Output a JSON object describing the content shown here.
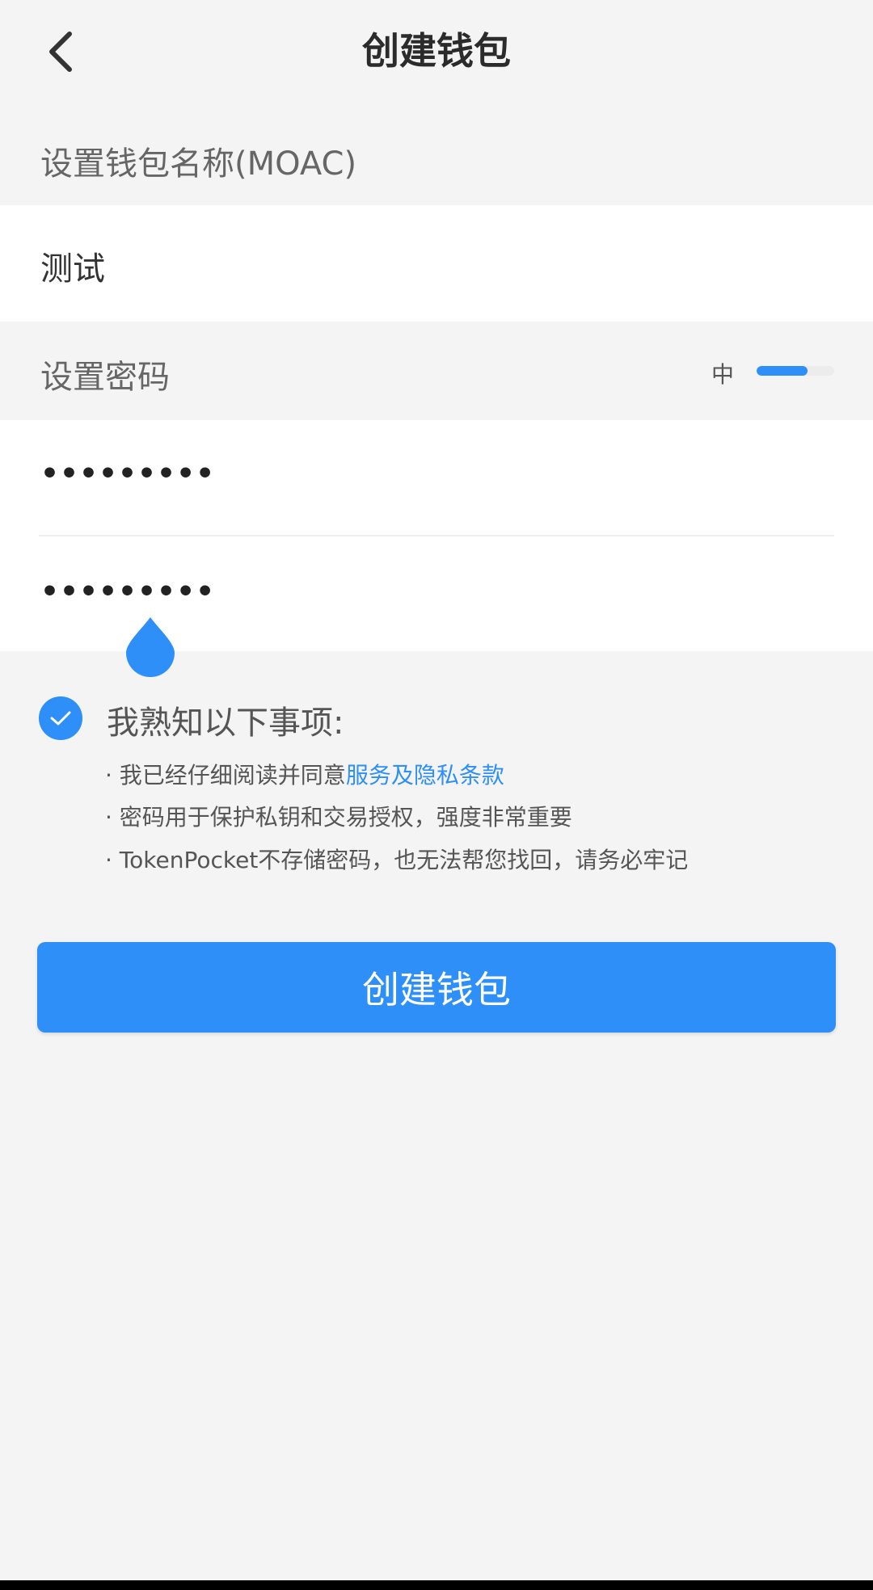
{
  "header": {
    "title": "创建钱包",
    "back_icon": "chevron-left-icon"
  },
  "wallet_name": {
    "label": "设置钱包名称(MOAC)",
    "value": "测试"
  },
  "password": {
    "label": "设置密码",
    "strength_text": "中",
    "strength_fraction": 0.66,
    "password_value": "•••••••••",
    "confirm_value": "•••••••••"
  },
  "acknowledge": {
    "checked": true,
    "title": "我熟知以下事项:",
    "item1_prefix": "· 我已经仔细阅读并同意",
    "item1_link": "服务及隐私条款",
    "item2": "· 密码用于保护私钥和交易授权，强度非常重要",
    "item3": "· TokenPocket不存储密码，也无法帮您找回，请务必牢记"
  },
  "actions": {
    "create_label": "创建钱包"
  },
  "colors": {
    "accent": "#2d8ff7",
    "background": "#f4f4f4",
    "panel": "#ffffff"
  }
}
